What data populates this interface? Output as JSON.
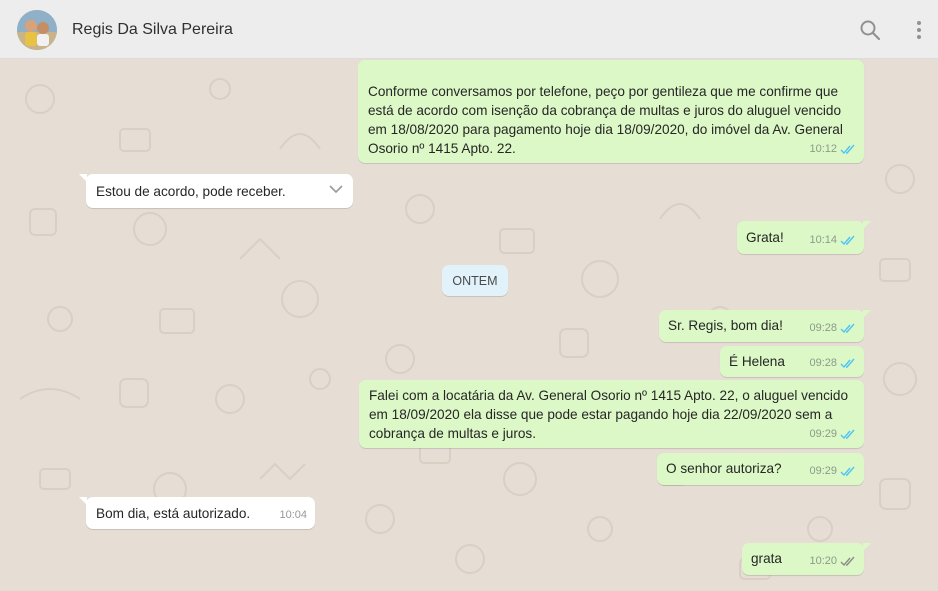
{
  "header": {
    "contact_name": "Regis Da Silva Pereira",
    "search_icon": "search-icon",
    "menu_icon": "more-vertical-icon"
  },
  "colors": {
    "header_bg": "#ededed",
    "chat_bg": "#e6ded5",
    "outgoing_bubble": "#dcf8c6",
    "incoming_bubble": "#ffffff",
    "date_chip": "#e1f2fb",
    "read_ticks": "#4fc3f7",
    "delivered_ticks": "#8c8c8c"
  },
  "date_separator": "ONTEM",
  "messages": [
    {
      "direction": "out",
      "text": "Conforme conversamos por telefone, peço por gentileza que me confirme que está de acordo com isenção da cobrança de multas e juros do aluguel vencido em 18/08/2020 para pagamento hoje dia 18/09/2020, do imóvel da Av. General Osorio nº 1415 Apto. 22.",
      "time": "10:12",
      "status": "read"
    },
    {
      "direction": "in",
      "text": "Estou de acordo, pode receber.",
      "time": ""
    },
    {
      "direction": "out",
      "text": "Grata!",
      "time": "10:14",
      "status": "read"
    },
    {
      "direction": "out",
      "text": "Sr. Regis, bom dia!",
      "time": "09:28",
      "status": "read"
    },
    {
      "direction": "out",
      "text": "É Helena",
      "time": "09:28",
      "status": "read"
    },
    {
      "direction": "out",
      "text": "Falei com a locatária da Av. General Osorio nº 1415 Apto. 22, o aluguel vencido em 18/09/2020 ela disse que pode estar pagando hoje dia 22/09/2020 sem a cobrança de multas e juros.",
      "time": "09:29",
      "status": "read"
    },
    {
      "direction": "out",
      "text": "O senhor autoriza?",
      "time": "09:29",
      "status": "read"
    },
    {
      "direction": "in",
      "text": "Bom dia, está autorizado.",
      "time": "10:04"
    },
    {
      "direction": "out",
      "text": "grata",
      "time": "10:20",
      "status": "delivered"
    }
  ]
}
